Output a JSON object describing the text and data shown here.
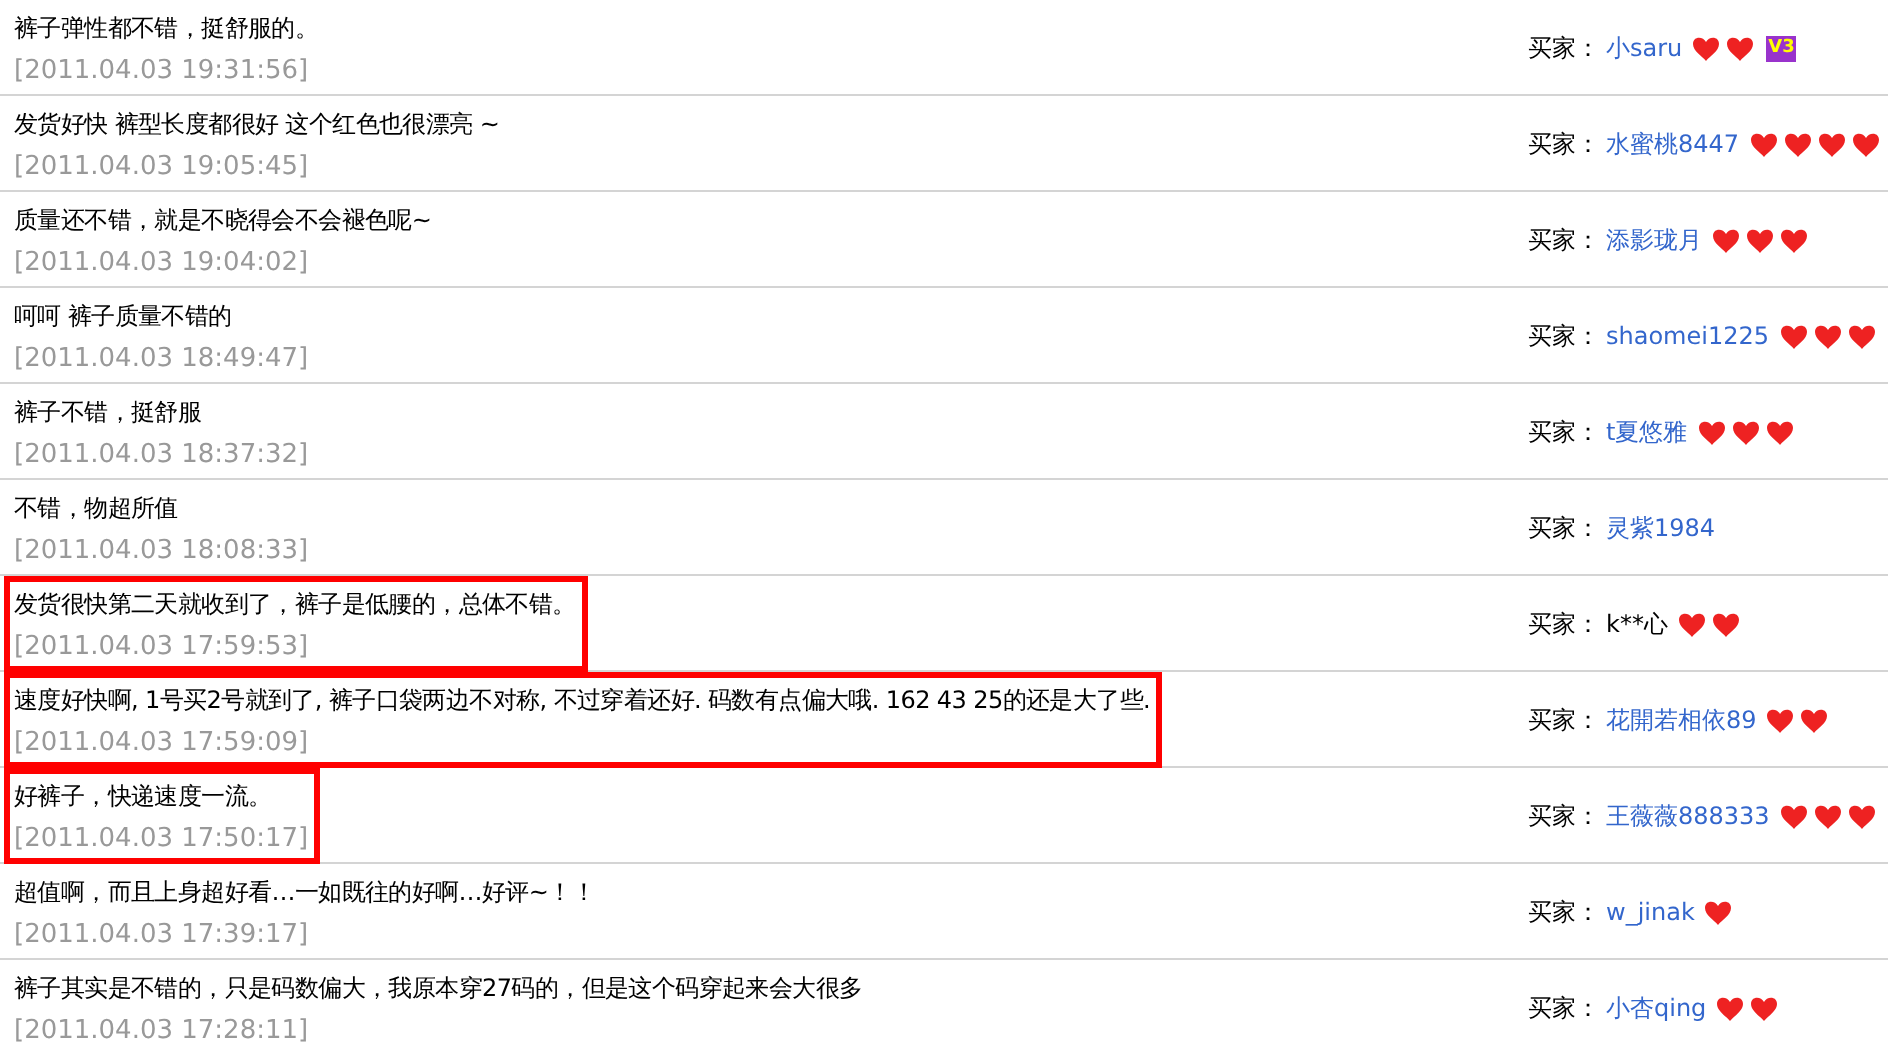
{
  "reviews": [
    {
      "comment": "裤子弹性都不错，挺舒服的。",
      "time": "[2011.04.03 19:31:56]",
      "highlighted": false,
      "buyer_label": "买家：",
      "buyer": "小saru",
      "linked": true,
      "credit_icons": [
        {
          "kind": "heart"
        },
        {
          "kind": "heart"
        }
      ],
      "badge": "V3"
    },
    {
      "comment": "发货好快 裤型长度都很好 这个红色也很漂亮 ~",
      "time": "[2011.04.03 19:05:45]",
      "highlighted": false,
      "buyer_label": "买家：",
      "buyer": "水蜜桃8447",
      "linked": true,
      "credit_icons": [
        {
          "kind": "heart"
        },
        {
          "kind": "heart"
        },
        {
          "kind": "heart"
        },
        {
          "kind": "heart"
        }
      ]
    },
    {
      "comment": "质量还不错，就是不晓得会不会褪色呢~",
      "time": "[2011.04.03 19:04:02]",
      "highlighted": false,
      "buyer_label": "买家：",
      "buyer": "添影珑月",
      "linked": true,
      "credit_icons": [
        {
          "kind": "heart"
        },
        {
          "kind": "heart"
        },
        {
          "kind": "heart"
        }
      ]
    },
    {
      "comment": "呵呵 裤子质量不错的",
      "time": "[2011.04.03 18:49:47]",
      "highlighted": false,
      "buyer_label": "买家：",
      "buyer": "shaomei1225",
      "linked": true,
      "credit_icons": [
        {
          "kind": "heart"
        },
        {
          "kind": "heart"
        },
        {
          "kind": "heart"
        }
      ]
    },
    {
      "comment": "裤子不错，挺舒服",
      "time": "[2011.04.03 18:37:32]",
      "highlighted": false,
      "buyer_label": "买家：",
      "buyer": "t夏悠雅",
      "linked": true,
      "credit_icons": [
        {
          "kind": "heart"
        },
        {
          "kind": "heart"
        },
        {
          "kind": "heart"
        }
      ]
    },
    {
      "comment": "不错，物超所值",
      "time": "[2011.04.03 18:08:33]",
      "highlighted": false,
      "buyer_label": "买家：",
      "buyer": "灵紫1984",
      "linked": true
    },
    {
      "comment": "发货很快第二天就收到了，裤子是低腰的，总体不错。",
      "time": "[2011.04.03 17:59:53]",
      "highlighted": true,
      "buyer_label": "买家：",
      "buyer": "k**心",
      "linked": false,
      "credit_icons": [
        {
          "kind": "heart"
        },
        {
          "kind": "heart"
        }
      ]
    },
    {
      "comment": "速度好快啊, 1号买2号就到了, 裤子口袋两边不对称, 不过穿着还好. 码数有点偏大哦. 162 43 25的还是大了些.",
      "time": "[2011.04.03 17:59:09]",
      "highlighted": true,
      "buyer_label": "买家：",
      "buyer": "花開若相依89",
      "linked": true,
      "credit_icons": [
        {
          "kind": "heart"
        },
        {
          "kind": "heart"
        }
      ]
    },
    {
      "comment": "好裤子，快递速度一流。",
      "time": "[2011.04.03 17:50:17]",
      "highlighted": true,
      "buyer_label": "买家：",
      "buyer": "王薇薇888333",
      "linked": true,
      "credit_icons": [
        {
          "kind": "heart"
        },
        {
          "kind": "heart"
        },
        {
          "kind": "heart"
        }
      ]
    },
    {
      "comment": "超值啊，而且上身超好看…一如既往的好啊…好评~！！",
      "time": "[2011.04.03 17:39:17]",
      "highlighted": false,
      "buyer_label": "买家：",
      "buyer": "w_jinak",
      "linked": true,
      "credit_icons": [
        {
          "kind": "heart"
        }
      ]
    },
    {
      "comment": "裤子其实是不错的，只是码数偏大，我原本穿27码的，但是这个码穿起来会大很多",
      "time": "[2011.04.03 17:28:11]",
      "highlighted": false,
      "buyer_label": "买家：",
      "buyer": "小杏qing",
      "linked": true,
      "credit_icons": [
        {
          "kind": "heart"
        },
        {
          "kind": "heart"
        }
      ]
    }
  ]
}
